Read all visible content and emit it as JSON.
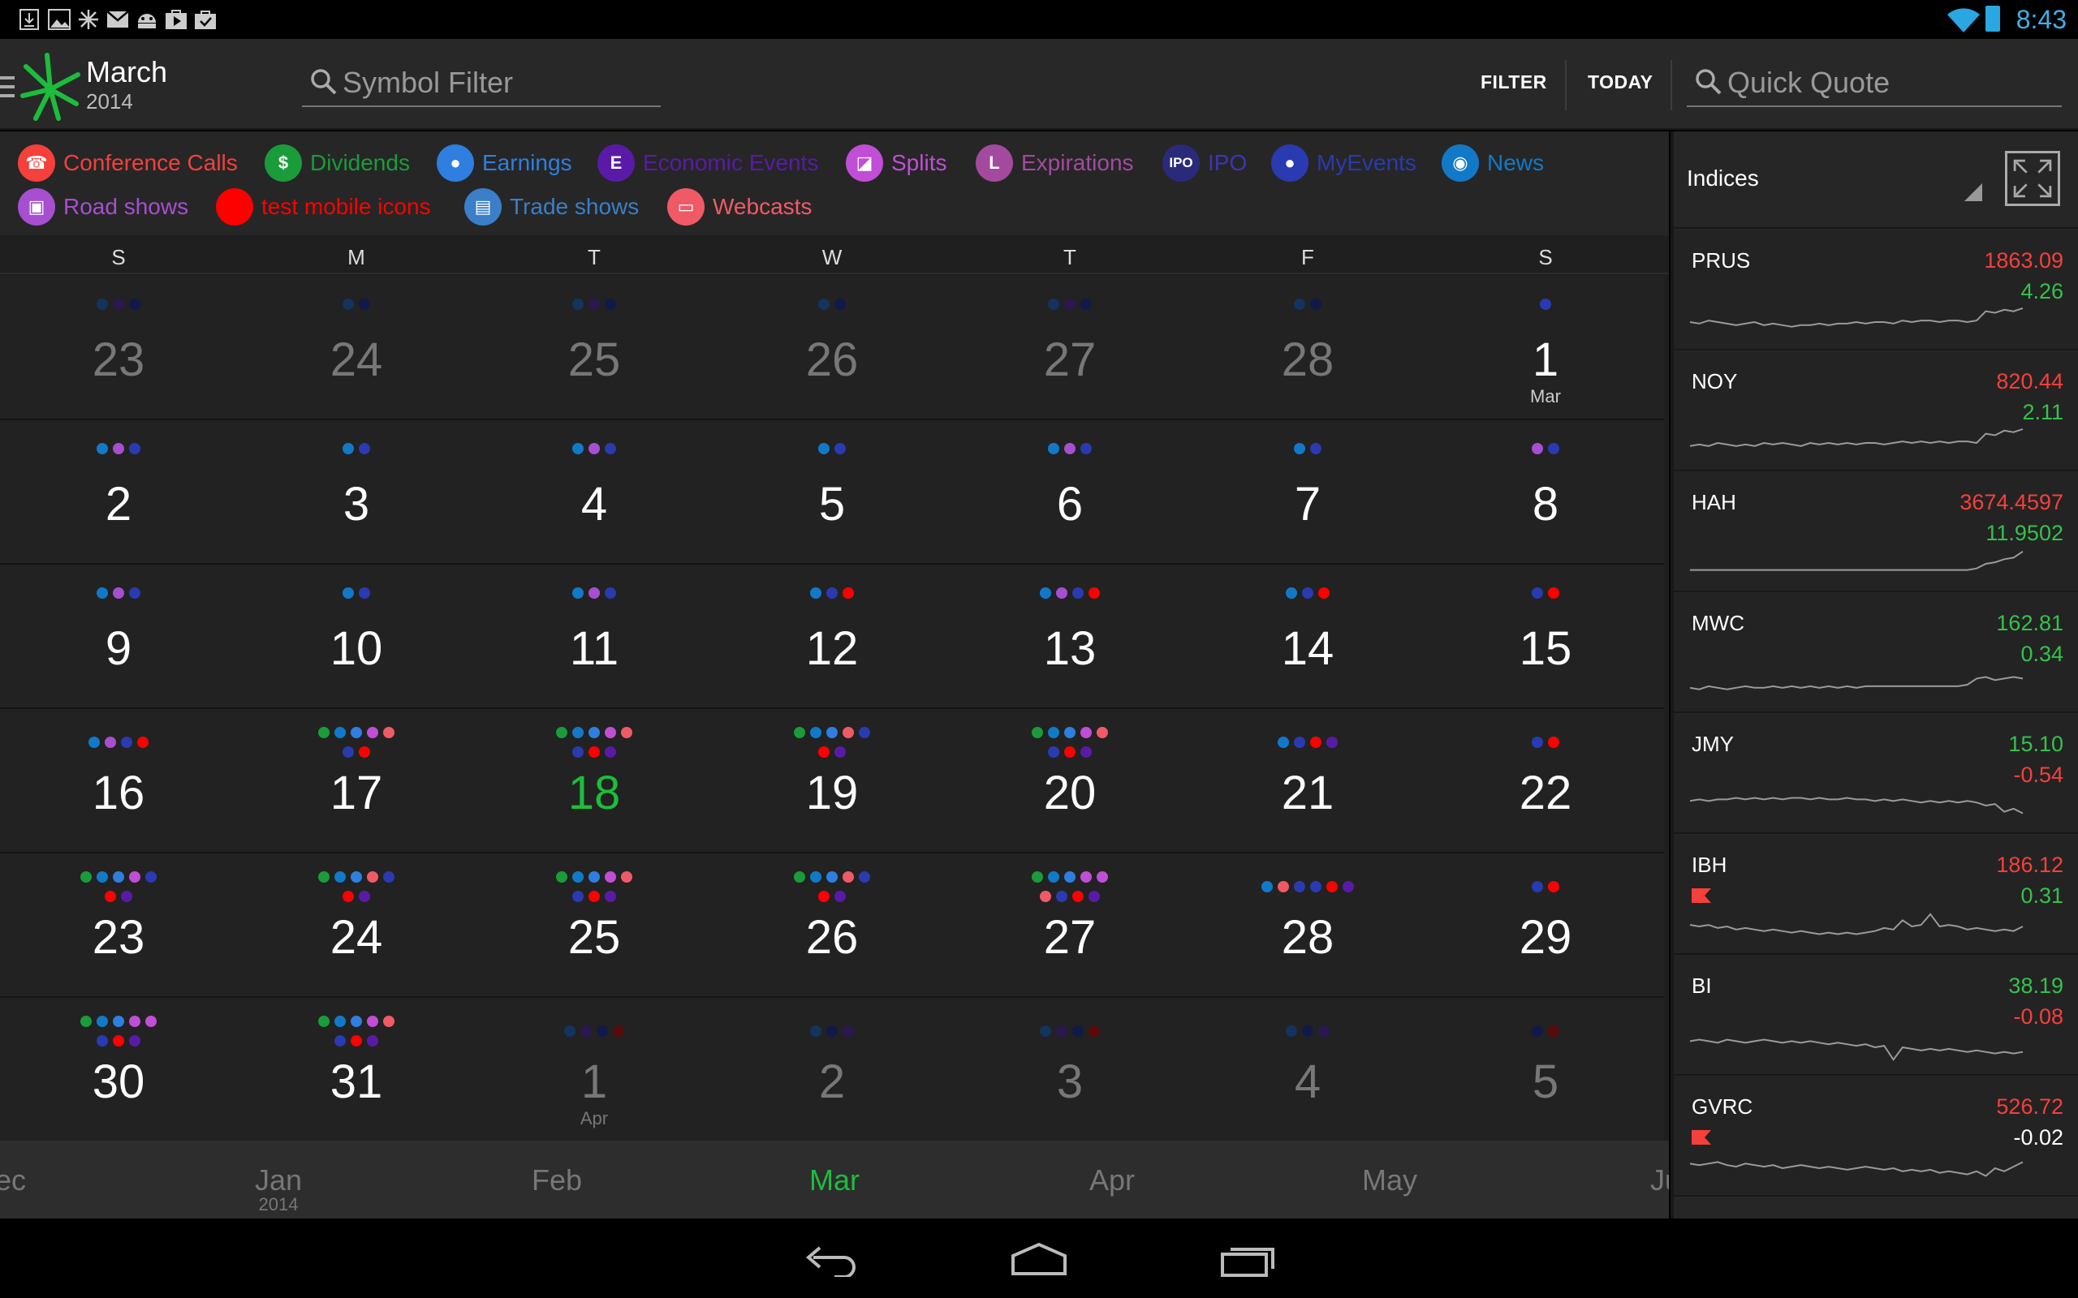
{
  "status_bar": {
    "time": "8:43",
    "notification_icons": [
      "download-icon",
      "image-icon",
      "pinwheel-icon",
      "gmail-icon",
      "android-icon",
      "play-store-icon",
      "shopping-bag-icon"
    ]
  },
  "header": {
    "month": "March",
    "year": "2014",
    "symbol_filter_placeholder": "Symbol Filter",
    "filter_label": "FILTER",
    "today_label": "TODAY",
    "quick_quote_placeholder": "Quick Quote"
  },
  "legend": [
    {
      "label": "Conference Calls",
      "color": "#f5403c",
      "icon": "phone-icon",
      "glyph": "☎"
    },
    {
      "label": "Dividends",
      "color": "#1a9c3a",
      "icon": "dollar-icon",
      "glyph": "$"
    },
    {
      "label": "Earnings",
      "color": "#2e7fe0",
      "icon": "bulb-icon",
      "glyph": "●"
    },
    {
      "label": "Economic Events",
      "color": "#5a1aa8",
      "icon": "economic-e-icon",
      "glyph": "E"
    },
    {
      "label": "Splits",
      "color": "#c04ed6",
      "icon": "splits-icon",
      "glyph": "◪"
    },
    {
      "label": "Expirations",
      "color": "#a34a9e",
      "icon": "clock-icon",
      "glyph": "L"
    },
    {
      "label": "IPO",
      "color": "#3c35b8",
      "icon": "ipo-icon",
      "glyph": "IPO"
    },
    {
      "label": "MyEvents",
      "color": "#2a3ab0",
      "icon": "pin-icon",
      "glyph": "●"
    },
    {
      "label": "News",
      "color": "#1279c9",
      "icon": "news-icon",
      "glyph": "◉"
    },
    {
      "label": "Road shows",
      "color": "#a64fd0",
      "icon": "bus-icon",
      "glyph": "▣"
    },
    {
      "label": "test mobile icons",
      "color": "#ff0000",
      "icon": "red-dot-icon",
      "glyph": ""
    },
    {
      "label": "Trade shows",
      "color": "#3a7fc8",
      "icon": "trade-show-icon",
      "glyph": "▤"
    },
    {
      "label": "Webcasts",
      "color": "#f05a66",
      "icon": "monitor-icon",
      "glyph": "▭"
    }
  ],
  "calendar": {
    "weekdays": [
      "S",
      "M",
      "T",
      "W",
      "T",
      "F",
      "S"
    ],
    "weeks": [
      [
        {
          "day": "23",
          "dim": true,
          "dots": [
            [
              "#14335e",
              "#2c1850",
              "#101a4a"
            ]
          ]
        },
        {
          "day": "24",
          "dim": true,
          "dots": [
            [
              "#14335e",
              "#101a4a"
            ]
          ]
        },
        {
          "day": "25",
          "dim": true,
          "dots": [
            [
              "#14335e",
              "#2c1850",
              "#101a4a"
            ]
          ]
        },
        {
          "day": "26",
          "dim": true,
          "dots": [
            [
              "#14335e",
              "#101a4a"
            ]
          ]
        },
        {
          "day": "27",
          "dim": true,
          "dots": [
            [
              "#14335e",
              "#2c1850",
              "#101a4a"
            ]
          ]
        },
        {
          "day": "28",
          "dim": true,
          "dots": [
            [
              "#14335e",
              "#101a4a"
            ]
          ]
        },
        {
          "day": "1",
          "month": "Mar",
          "dots": [
            [
              "#2a3ab0"
            ]
          ]
        }
      ],
      [
        {
          "day": "2",
          "dots": [
            [
              "#1279c9",
              "#a64fd0",
              "#2a3ab0"
            ]
          ]
        },
        {
          "day": "3",
          "dots": [
            [
              "#1279c9",
              "#2a3ab0"
            ]
          ]
        },
        {
          "day": "4",
          "dots": [
            [
              "#1279c9",
              "#a64fd0",
              "#2a3ab0"
            ]
          ]
        },
        {
          "day": "5",
          "dots": [
            [
              "#1279c9",
              "#2a3ab0"
            ]
          ]
        },
        {
          "day": "6",
          "dots": [
            [
              "#1279c9",
              "#a64fd0",
              "#2a3ab0"
            ]
          ]
        },
        {
          "day": "7",
          "dots": [
            [
              "#1279c9",
              "#2a3ab0"
            ]
          ]
        },
        {
          "day": "8",
          "dots": [
            [
              "#a64fd0",
              "#2a3ab0"
            ]
          ]
        }
      ],
      [
        {
          "day": "9",
          "dots": [
            [
              "#1279c9",
              "#a64fd0",
              "#2a3ab0"
            ]
          ]
        },
        {
          "day": "10",
          "dots": [
            [
              "#1279c9",
              "#2a3ab0"
            ]
          ]
        },
        {
          "day": "11",
          "dots": [
            [
              "#1279c9",
              "#a64fd0",
              "#2a3ab0"
            ]
          ]
        },
        {
          "day": "12",
          "dots": [
            [
              "#1279c9",
              "#2a3ab0",
              "#ff0000"
            ]
          ]
        },
        {
          "day": "13",
          "dots": [
            [
              "#1279c9",
              "#a64fd0",
              "#2a3ab0",
              "#ff0000"
            ]
          ]
        },
        {
          "day": "14",
          "dots": [
            [
              "#1279c9",
              "#2a3ab0",
              "#ff0000"
            ]
          ]
        },
        {
          "day": "15",
          "dots": [
            [
              "#2a3ab0",
              "#ff0000"
            ]
          ]
        }
      ],
      [
        {
          "day": "16",
          "dots": [
            [
              "#1279c9",
              "#a64fd0",
              "#2a3ab0",
              "#ff0000"
            ]
          ]
        },
        {
          "day": "17",
          "dots": [
            [
              "#1a9c3a",
              "#1279c9",
              "#2e7fe0",
              "#c04ed6",
              "#f05a66"
            ],
            [
              "#2a3ab0",
              "#ff0000"
            ]
          ]
        },
        {
          "day": "18",
          "today": true,
          "dots": [
            [
              "#1a9c3a",
              "#1279c9",
              "#2e7fe0",
              "#c04ed6",
              "#f05a66"
            ],
            [
              "#2a3ab0",
              "#ff0000",
              "#5a1aa8"
            ]
          ]
        },
        {
          "day": "19",
          "dots": [
            [
              "#1a9c3a",
              "#1279c9",
              "#2e7fe0",
              "#f05a66",
              "#2a3ab0"
            ],
            [
              "#ff0000",
              "#5a1aa8"
            ]
          ]
        },
        {
          "day": "20",
          "dots": [
            [
              "#1a9c3a",
              "#1279c9",
              "#2e7fe0",
              "#c04ed6",
              "#f05a66"
            ],
            [
              "#2a3ab0",
              "#ff0000",
              "#5a1aa8"
            ]
          ]
        },
        {
          "day": "21",
          "dots": [
            [
              "#1279c9",
              "#2a3ab0",
              "#ff0000",
              "#5a1aa8"
            ]
          ]
        },
        {
          "day": "22",
          "dots": [
            [
              "#2a3ab0",
              "#ff0000"
            ]
          ]
        }
      ],
      [
        {
          "day": "23",
          "dots": [
            [
              "#1a9c3a",
              "#1279c9",
              "#2e7fe0",
              "#c04ed6",
              "#2a3ab0"
            ],
            [
              "#ff0000",
              "#5a1aa8"
            ]
          ]
        },
        {
          "day": "24",
          "dots": [
            [
              "#1a9c3a",
              "#1279c9",
              "#2e7fe0",
              "#f05a66",
              "#2a3ab0"
            ],
            [
              "#ff0000",
              "#5a1aa8"
            ]
          ]
        },
        {
          "day": "25",
          "dots": [
            [
              "#1a9c3a",
              "#1279c9",
              "#2e7fe0",
              "#c04ed6",
              "#f05a66"
            ],
            [
              "#2a3ab0",
              "#ff0000",
              "#5a1aa8"
            ]
          ]
        },
        {
          "day": "26",
          "dots": [
            [
              "#1a9c3a",
              "#1279c9",
              "#2e7fe0",
              "#f05a66",
              "#2a3ab0"
            ],
            [
              "#ff0000",
              "#5a1aa8"
            ]
          ]
        },
        {
          "day": "27",
          "dots": [
            [
              "#1a9c3a",
              "#1279c9",
              "#2e7fe0",
              "#c04ed6",
              "#c04ed6"
            ],
            [
              "#f05a66",
              "#2a3ab0",
              "#ff0000",
              "#5a1aa8"
            ]
          ]
        },
        {
          "day": "28",
          "dots": [
            [
              "#1279c9",
              "#f05a66",
              "#2a3ab0",
              "#2a3ab0",
              "#ff0000",
              "#5a1aa8"
            ]
          ]
        },
        {
          "day": "29",
          "dots": [
            [
              "#2a3ab0",
              "#ff0000"
            ]
          ]
        }
      ],
      [
        {
          "day": "30",
          "dots": [
            [
              "#1a9c3a",
              "#1279c9",
              "#2e7fe0",
              "#c04ed6",
              "#c04ed6"
            ],
            [
              "#2a3ab0",
              "#ff0000",
              "#5a1aa8"
            ]
          ]
        },
        {
          "day": "31",
          "dots": [
            [
              "#1a9c3a",
              "#1279c9",
              "#2e7fe0",
              "#c04ed6",
              "#f05a66"
            ],
            [
              "#2a3ab0",
              "#ff0000",
              "#5a1aa8"
            ]
          ]
        },
        {
          "day": "1",
          "month": "Apr",
          "dim": true,
          "dots": [
            [
              "#14335e",
              "#2c1850",
              "#101a4a",
              "#5a0a0a"
            ]
          ]
        },
        {
          "day": "2",
          "dim": true,
          "dots": [
            [
              "#14335e",
              "#101a4a",
              "#2c1850"
            ]
          ]
        },
        {
          "day": "3",
          "dim": true,
          "dots": [
            [
              "#14335e",
              "#2c1850",
              "#101a4a",
              "#5a0a0a"
            ]
          ]
        },
        {
          "day": "4",
          "dim": true,
          "dots": [
            [
              "#14335e",
              "#101a4a",
              "#2c1850"
            ]
          ]
        },
        {
          "day": "5",
          "dim": true,
          "dots": [
            [
              "#101a4a",
              "#5a0a0a"
            ]
          ]
        }
      ]
    ]
  },
  "month_scroller": {
    "items": [
      {
        "label": "ec",
        "sub": ""
      },
      {
        "label": "Jan",
        "sub": "2014"
      },
      {
        "label": "Feb",
        "sub": ""
      },
      {
        "label": "Mar",
        "sub": "",
        "active": true
      },
      {
        "label": "Apr",
        "sub": ""
      },
      {
        "label": "May",
        "sub": ""
      },
      {
        "label": "Ju",
        "sub": ""
      }
    ]
  },
  "indices": {
    "title": "Indices",
    "quotes": [
      {
        "symbol": "PRUS",
        "price": "1863.09",
        "price_color": "red",
        "change": "4.26",
        "change_color": "green",
        "flag": false,
        "spark": [
          0.5,
          0.55,
          0.45,
          0.5,
          0.55,
          0.6,
          0.55,
          0.5,
          0.6,
          0.55,
          0.6,
          0.65,
          0.6,
          0.6,
          0.55,
          0.6,
          0.55,
          0.55,
          0.5,
          0.55,
          0.5,
          0.5,
          0.55,
          0.45,
          0.5,
          0.45,
          0.45,
          0.5,
          0.45,
          0.45,
          0.5,
          0.45,
          0.15,
          0.2,
          0.1,
          0.15,
          0.05
        ]
      },
      {
        "symbol": "NOY",
        "price": "820.44",
        "price_color": "red",
        "change": "2.11",
        "change_color": "green",
        "flag": false,
        "spark": [
          0.6,
          0.55,
          0.6,
          0.5,
          0.55,
          0.6,
          0.55,
          0.6,
          0.5,
          0.55,
          0.5,
          0.55,
          0.6,
          0.5,
          0.55,
          0.5,
          0.55,
          0.5,
          0.55,
          0.5,
          0.5,
          0.55,
          0.5,
          0.45,
          0.5,
          0.45,
          0.5,
          0.45,
          0.5,
          0.45,
          0.45,
          0.5,
          0.2,
          0.25,
          0.1,
          0.15,
          0.05
        ]
      },
      {
        "symbol": "HAH",
        "price": "3674.4597",
        "price_color": "red",
        "change": "11.9502",
        "change_color": "green",
        "flag": false,
        "spark": [
          0.7,
          0.7,
          0.7,
          0.7,
          0.7,
          0.7,
          0.7,
          0.7,
          0.7,
          0.7,
          0.7,
          0.7,
          0.7,
          0.7,
          0.7,
          0.7,
          0.7,
          0.7,
          0.7,
          0.7,
          0.7,
          0.7,
          0.7,
          0.7,
          0.7,
          0.7,
          0.7,
          0.7,
          0.7,
          0.7,
          0.7,
          0.65,
          0.5,
          0.45,
          0.35,
          0.3,
          0.1
        ]
      },
      {
        "symbol": "MWC",
        "price": "162.81",
        "price_color": "green",
        "change": "0.34",
        "change_color": "green",
        "flag": false,
        "spark": [
          0.6,
          0.65,
          0.55,
          0.6,
          0.65,
          0.6,
          0.55,
          0.6,
          0.6,
          0.55,
          0.6,
          0.55,
          0.6,
          0.55,
          0.6,
          0.55,
          0.6,
          0.55,
          0.6,
          0.55,
          0.55,
          0.55,
          0.55,
          0.55,
          0.55,
          0.55,
          0.55,
          0.55,
          0.55,
          0.55,
          0.5,
          0.3,
          0.25,
          0.35,
          0.3,
          0.25,
          0.3
        ]
      },
      {
        "symbol": "JMY",
        "price": "15.10",
        "price_color": "green",
        "change": "-0.54",
        "change_color": "red",
        "flag": false,
        "spark": [
          0.35,
          0.3,
          0.35,
          0.3,
          0.3,
          0.25,
          0.3,
          0.25,
          0.3,
          0.25,
          0.3,
          0.25,
          0.25,
          0.3,
          0.25,
          0.3,
          0.3,
          0.25,
          0.3,
          0.3,
          0.35,
          0.3,
          0.35,
          0.3,
          0.35,
          0.4,
          0.35,
          0.4,
          0.35,
          0.4,
          0.35,
          0.4,
          0.5,
          0.45,
          0.7,
          0.6,
          0.75
        ]
      },
      {
        "symbol": "IBH",
        "price": "186.12",
        "price_color": "red",
        "change": "0.31",
        "change_color": "green",
        "flag": true,
        "spark": [
          0.45,
          0.5,
          0.45,
          0.55,
          0.5,
          0.6,
          0.55,
          0.6,
          0.65,
          0.6,
          0.65,
          0.7,
          0.65,
          0.7,
          0.75,
          0.7,
          0.75,
          0.7,
          0.75,
          0.7,
          0.65,
          0.55,
          0.6,
          0.3,
          0.5,
          0.45,
          0.1,
          0.5,
          0.45,
          0.5,
          0.6,
          0.55,
          0.6,
          0.65,
          0.6,
          0.65,
          0.5
        ]
      },
      {
        "symbol": "BI",
        "price": "38.19",
        "price_color": "green",
        "change": "-0.08",
        "change_color": "red",
        "flag": false,
        "spark": [
          0.3,
          0.25,
          0.3,
          0.35,
          0.25,
          0.3,
          0.35,
          0.3,
          0.25,
          0.3,
          0.35,
          0.3,
          0.35,
          0.3,
          0.35,
          0.4,
          0.35,
          0.4,
          0.45,
          0.4,
          0.5,
          0.45,
          0.9,
          0.5,
          0.55,
          0.6,
          0.55,
          0.6,
          0.55,
          0.6,
          0.65,
          0.6,
          0.65,
          0.7,
          0.65,
          0.7,
          0.65
        ]
      },
      {
        "symbol": "GVRC",
        "price": "526.72",
        "price_color": "red",
        "change": "-0.02",
        "change_color": "white",
        "flag": true,
        "spark": [
          0.35,
          0.4,
          0.35,
          0.3,
          0.4,
          0.45,
          0.35,
          0.4,
          0.45,
          0.4,
          0.5,
          0.45,
          0.4,
          0.45,
          0.5,
          0.45,
          0.5,
          0.55,
          0.5,
          0.45,
          0.5,
          0.55,
          0.5,
          0.6,
          0.55,
          0.6,
          0.55,
          0.65,
          0.6,
          0.65,
          0.7,
          0.6,
          0.75,
          0.5,
          0.6,
          0.45,
          0.3
        ]
      }
    ]
  },
  "nav_bar": {
    "icons": [
      "back-icon",
      "home-icon",
      "recents-icon"
    ]
  }
}
